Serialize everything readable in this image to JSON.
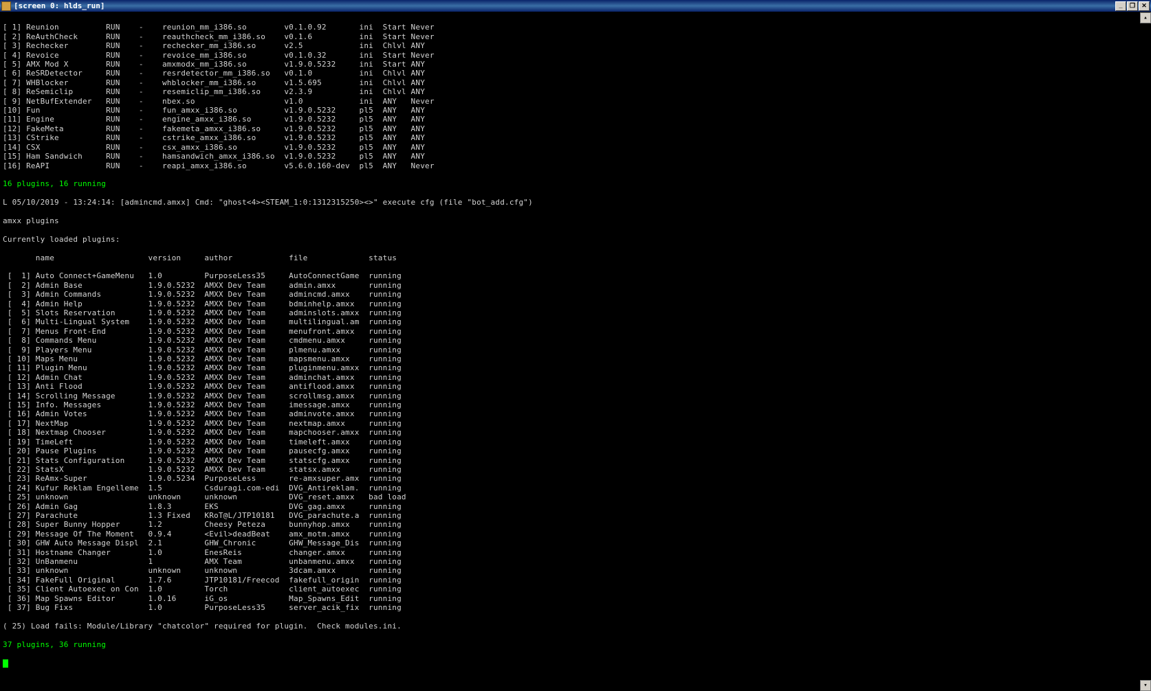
{
  "window": {
    "title": "[screen 0: hlds_run]",
    "min_label": "_",
    "max_label": "❐",
    "close_label": "✕"
  },
  "meta_plugins": [
    {
      "idx": "[ 1]",
      "name": "Reunion",
      "stat": "RUN",
      "dash": "-",
      "file": "reunion_mm_i386.so",
      "ver": "v0.1.0.92",
      "src": "ini",
      "load": "Start",
      "unload": "Never"
    },
    {
      "idx": "[ 2]",
      "name": "ReAuthCheck",
      "stat": "RUN",
      "dash": "-",
      "file": "reauthcheck_mm_i386.so",
      "ver": "v0.1.6",
      "src": "ini",
      "load": "Start",
      "unload": "Never"
    },
    {
      "idx": "[ 3]",
      "name": "Rechecker",
      "stat": "RUN",
      "dash": "-",
      "file": "rechecker_mm_i386.so",
      "ver": "v2.5",
      "src": "ini",
      "load": "Chlvl",
      "unload": "ANY"
    },
    {
      "idx": "[ 4]",
      "name": "Revoice",
      "stat": "RUN",
      "dash": "-",
      "file": "revoice_mm_i386.so",
      "ver": "v0.1.0.32",
      "src": "ini",
      "load": "Start",
      "unload": "Never"
    },
    {
      "idx": "[ 5]",
      "name": "AMX Mod X",
      "stat": "RUN",
      "dash": "-",
      "file": "amxmodx_mm_i386.so",
      "ver": "v1.9.0.5232",
      "src": "ini",
      "load": "Start",
      "unload": "ANY"
    },
    {
      "idx": "[ 6]",
      "name": "ReSRDetector",
      "stat": "RUN",
      "dash": "-",
      "file": "resrdetector_mm_i386.so",
      "ver": "v0.1.0",
      "src": "ini",
      "load": "Chlvl",
      "unload": "ANY"
    },
    {
      "idx": "[ 7]",
      "name": "WHBlocker",
      "stat": "RUN",
      "dash": "-",
      "file": "whblocker_mm_i386.so",
      "ver": "v1.5.695",
      "src": "ini",
      "load": "Chlvl",
      "unload": "ANY"
    },
    {
      "idx": "[ 8]",
      "name": "ReSemiclip",
      "stat": "RUN",
      "dash": "-",
      "file": "resemiclip_mm_i386.so",
      "ver": "v2.3.9",
      "src": "ini",
      "load": "Chlvl",
      "unload": "ANY"
    },
    {
      "idx": "[ 9]",
      "name": "NetBufExtender",
      "stat": "RUN",
      "dash": "-",
      "file": "nbex.so",
      "ver": "v1.0",
      "src": "ini",
      "load": "ANY",
      "unload": "Never"
    },
    {
      "idx": "[10]",
      "name": "Fun",
      "stat": "RUN",
      "dash": "-",
      "file": "fun_amxx_i386.so",
      "ver": "v1.9.0.5232",
      "src": "pl5",
      "load": "ANY",
      "unload": "ANY"
    },
    {
      "idx": "[11]",
      "name": "Engine",
      "stat": "RUN",
      "dash": "-",
      "file": "engine_amxx_i386.so",
      "ver": "v1.9.0.5232",
      "src": "pl5",
      "load": "ANY",
      "unload": "ANY"
    },
    {
      "idx": "[12]",
      "name": "FakeMeta",
      "stat": "RUN",
      "dash": "-",
      "file": "fakemeta_amxx_i386.so",
      "ver": "v1.9.0.5232",
      "src": "pl5",
      "load": "ANY",
      "unload": "ANY"
    },
    {
      "idx": "[13]",
      "name": "CStrike",
      "stat": "RUN",
      "dash": "-",
      "file": "cstrike_amxx_i386.so",
      "ver": "v1.9.0.5232",
      "src": "pl5",
      "load": "ANY",
      "unload": "ANY"
    },
    {
      "idx": "[14]",
      "name": "CSX",
      "stat": "RUN",
      "dash": "-",
      "file": "csx_amxx_i386.so",
      "ver": "v1.9.0.5232",
      "src": "pl5",
      "load": "ANY",
      "unload": "ANY"
    },
    {
      "idx": "[15]",
      "name": "Ham Sandwich",
      "stat": "RUN",
      "dash": "-",
      "file": "hamsandwich_amxx_i386.so",
      "ver": "v1.9.0.5232",
      "src": "pl5",
      "load": "ANY",
      "unload": "ANY"
    },
    {
      "idx": "[16]",
      "name": "ReAPI",
      "stat": "RUN",
      "dash": "-",
      "file": "reapi_amxx_i386.so",
      "ver": "v5.6.0.160-dev",
      "src": "pl5",
      "load": "ANY",
      "unload": "Never"
    }
  ],
  "meta_summary": "16 plugins, 16 running",
  "log_line": "L 05/10/2019 - 13:24:14: [admincmd.amxx] Cmd: \"ghost<4><STEAM_1:0:1312315250><>\" execute cfg (file \"bot_add.cfg\")",
  "amxx_cmd": "amxx plugins",
  "amxx_header": "Currently loaded plugins:",
  "amxx_col_header": {
    "idx": "",
    "name": "name",
    "version": "version",
    "author": "author",
    "file": "file",
    "status": "status"
  },
  "amxx_plugins": [
    {
      "idx": "[  1]",
      "name": "Auto Connect+GameMenu",
      "ver": "1.0",
      "author": "PurposeLess35",
      "file": "AutoConnectGame",
      "status": "running"
    },
    {
      "idx": "[  2]",
      "name": "Admin Base",
      "ver": "1.9.0.5232",
      "author": "AMXX Dev Team",
      "file": "admin.amxx",
      "status": "running"
    },
    {
      "idx": "[  3]",
      "name": "Admin Commands",
      "ver": "1.9.0.5232",
      "author": "AMXX Dev Team",
      "file": "admincmd.amxx",
      "status": "running"
    },
    {
      "idx": "[  4]",
      "name": "Admin Help",
      "ver": "1.9.0.5232",
      "author": "AMXX Dev Team",
      "file": "bdminhelp.amxx",
      "status": "running"
    },
    {
      "idx": "[  5]",
      "name": "Slots Reservation",
      "ver": "1.9.0.5232",
      "author": "AMXX Dev Team",
      "file": "adminslots.amxx",
      "status": "running"
    },
    {
      "idx": "[  6]",
      "name": "Multi-Lingual System",
      "ver": "1.9.0.5232",
      "author": "AMXX Dev Team",
      "file": "multilingual.am",
      "status": "running"
    },
    {
      "idx": "[  7]",
      "name": "Menus Front-End",
      "ver": "1.9.0.5232",
      "author": "AMXX Dev Team",
      "file": "menufront.amxx",
      "status": "running"
    },
    {
      "idx": "[  8]",
      "name": "Commands Menu",
      "ver": "1.9.0.5232",
      "author": "AMXX Dev Team",
      "file": "cmdmenu.amxx",
      "status": "running"
    },
    {
      "idx": "[  9]",
      "name": "Players Menu",
      "ver": "1.9.0.5232",
      "author": "AMXX Dev Team",
      "file": "plmenu.amxx",
      "status": "running"
    },
    {
      "idx": "[ 10]",
      "name": "Maps Menu",
      "ver": "1.9.0.5232",
      "author": "AMXX Dev Team",
      "file": "mapsmenu.amxx",
      "status": "running"
    },
    {
      "idx": "[ 11]",
      "name": "Plugin Menu",
      "ver": "1.9.0.5232",
      "author": "AMXX Dev Team",
      "file": "pluginmenu.amxx",
      "status": "running"
    },
    {
      "idx": "[ 12]",
      "name": "Admin Chat",
      "ver": "1.9.0.5232",
      "author": "AMXX Dev Team",
      "file": "adminchat.amxx",
      "status": "running"
    },
    {
      "idx": "[ 13]",
      "name": "Anti Flood",
      "ver": "1.9.0.5232",
      "author": "AMXX Dev Team",
      "file": "antiflood.amxx",
      "status": "running"
    },
    {
      "idx": "[ 14]",
      "name": "Scrolling Message",
      "ver": "1.9.0.5232",
      "author": "AMXX Dev Team",
      "file": "scrollmsg.amxx",
      "status": "running"
    },
    {
      "idx": "[ 15]",
      "name": "Info. Messages",
      "ver": "1.9.0.5232",
      "author": "AMXX Dev Team",
      "file": "imessage.amxx",
      "status": "running"
    },
    {
      "idx": "[ 16]",
      "name": "Admin Votes",
      "ver": "1.9.0.5232",
      "author": "AMXX Dev Team",
      "file": "adminvote.amxx",
      "status": "running"
    },
    {
      "idx": "[ 17]",
      "name": "NextMap",
      "ver": "1.9.0.5232",
      "author": "AMXX Dev Team",
      "file": "nextmap.amxx",
      "status": "running"
    },
    {
      "idx": "[ 18]",
      "name": "Nextmap Chooser",
      "ver": "1.9.0.5232",
      "author": "AMXX Dev Team",
      "file": "mapchooser.amxx",
      "status": "running"
    },
    {
      "idx": "[ 19]",
      "name": "TimeLeft",
      "ver": "1.9.0.5232",
      "author": "AMXX Dev Team",
      "file": "timeleft.amxx",
      "status": "running"
    },
    {
      "idx": "[ 20]",
      "name": "Pause Plugins",
      "ver": "1.9.0.5232",
      "author": "AMXX Dev Team",
      "file": "pausecfg.amxx",
      "status": "running"
    },
    {
      "idx": "[ 21]",
      "name": "Stats Configuration",
      "ver": "1.9.0.5232",
      "author": "AMXX Dev Team",
      "file": "statscfg.amxx",
      "status": "running"
    },
    {
      "idx": "[ 22]",
      "name": "StatsX",
      "ver": "1.9.0.5232",
      "author": "AMXX Dev Team",
      "file": "statsx.amxx",
      "status": "running"
    },
    {
      "idx": "[ 23]",
      "name": "ReAmx-Super",
      "ver": "1.9.0.5234",
      "author": "PurposeLess",
      "file": "re-amxsuper.amx",
      "status": "running"
    },
    {
      "idx": "[ 24]",
      "name": "Kufur Reklam Engelleme",
      "ver": "1.5",
      "author": "Csduragi.com-edi",
      "file": "DVG_Antireklam.",
      "status": "running"
    },
    {
      "idx": "[ 25]",
      "name": "unknown",
      "ver": "unknown",
      "author": "unknown",
      "file": "DVG_reset.amxx",
      "status": "bad load"
    },
    {
      "idx": "[ 26]",
      "name": "Admin Gag",
      "ver": "1.8.3",
      "author": "EKS",
      "file": "DVG_gag.amxx",
      "status": "running"
    },
    {
      "idx": "[ 27]",
      "name": "Parachute",
      "ver": "1.3 Fixed",
      "author": "KRoT@L/JTP10181",
      "file": "DVG_parachute.a",
      "status": "running"
    },
    {
      "idx": "[ 28]",
      "name": "Super Bunny Hopper",
      "ver": "1.2",
      "author": "Cheesy Peteza",
      "file": "bunnyhop.amxx",
      "status": "running"
    },
    {
      "idx": "[ 29]",
      "name": "Message Of The Moment",
      "ver": "0.9.4",
      "author": "<Evil>deadBeat",
      "file": "amx_motm.amxx",
      "status": "running"
    },
    {
      "idx": "[ 30]",
      "name": "GHW Auto Message Displ",
      "ver": "2.1",
      "author": "GHW_Chronic",
      "file": "GHW_Message_Dis",
      "status": "running"
    },
    {
      "idx": "[ 31]",
      "name": "Hostname Changer",
      "ver": "1.0",
      "author": "EnesReis",
      "file": "changer.amxx",
      "status": "running"
    },
    {
      "idx": "[ 32]",
      "name": "UnBanmenu",
      "ver": "1",
      "author": "AMX Team",
      "file": "unbanmenu.amxx",
      "status": "running"
    },
    {
      "idx": "[ 33]",
      "name": "unknown",
      "ver": "unknown",
      "author": "unknown",
      "file": "3dcam.amxx",
      "status": "running"
    },
    {
      "idx": "[ 34]",
      "name": "FakeFull Original",
      "ver": "1.7.6",
      "author": "JTP10181/Freecod",
      "file": "fakefull_origin",
      "status": "running"
    },
    {
      "idx": "[ 35]",
      "name": "Client Autoexec on Con",
      "ver": "1.0",
      "author": "Torch",
      "file": "client_autoexec",
      "status": "running"
    },
    {
      "idx": "[ 36]",
      "name": "Map Spawns Editor",
      "ver": "1.0.16",
      "author": "iG_os",
      "file": "Map_Spawns_Edit",
      "status": "running"
    },
    {
      "idx": "[ 37]",
      "name": "Bug Fixs",
      "ver": "1.0",
      "author": "PurposeLess35",
      "file": "server_acik_fix",
      "status": "running"
    }
  ],
  "load_fail": "( 25) Load fails: Module/Library \"chatcolor\" required for plugin.  Check modules.ini.",
  "amxx_summary": "37 plugins, 36 running"
}
